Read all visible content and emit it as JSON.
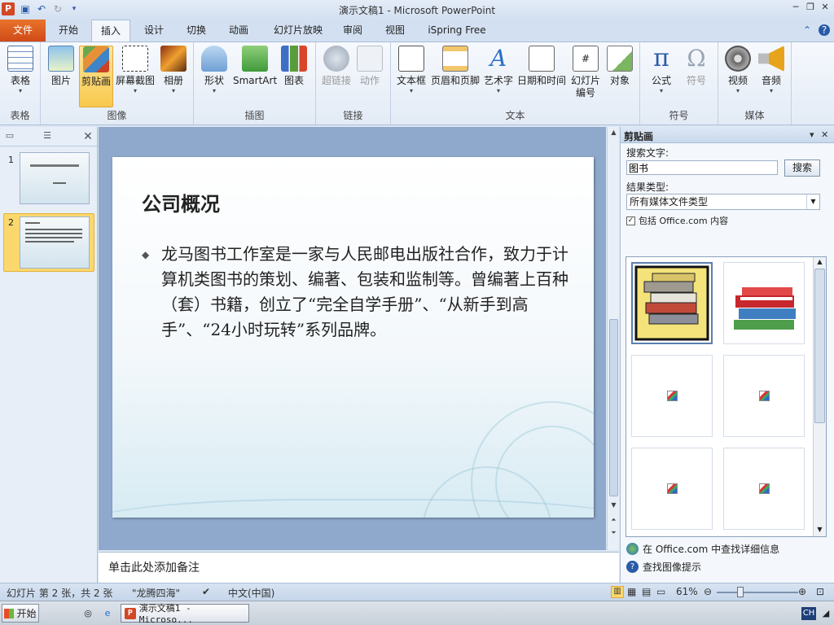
{
  "window": {
    "title": "演示文稿1 - Microsoft PowerPoint",
    "app_icon": "P",
    "controls": [
      "minimize-icon",
      "restore-icon",
      "close-icon"
    ]
  },
  "tabs": {
    "file": "文件",
    "items": [
      "开始",
      "插入",
      "设计",
      "切换",
      "动画",
      "幻灯片放映",
      "审阅",
      "视图",
      "iSpring Free"
    ],
    "active": "插入"
  },
  "ribbon": {
    "groups": {
      "table": "表格",
      "images": "图像",
      "illustrations": "插图",
      "links": "链接",
      "text": "文本",
      "symbols": "符号",
      "media": "媒体"
    },
    "buttons": {
      "table": "表格",
      "picture": "图片",
      "clipart": "剪贴画",
      "screenshot": "屏幕截图",
      "album": "相册",
      "shapes": "形状",
      "smartart": "SmartArt",
      "chart": "图表",
      "hyperlink": "超链接",
      "action": "动作",
      "textbox": "文本框",
      "header_footer": "页眉和页脚",
      "wordart": "艺术字",
      "datetime": "日期和时间",
      "slide_number_1": "幻灯片",
      "slide_number_2": "编号",
      "object": "对象",
      "equation": "公式",
      "symbol": "符号",
      "video": "视频",
      "audio": "音频"
    }
  },
  "slides_panel": {
    "slides": [
      {
        "number": "1",
        "title": "龙马工作室产品宣传"
      },
      {
        "number": "2",
        "title": "公司概况"
      }
    ],
    "selected": 2
  },
  "slide": {
    "title": "公司概况",
    "body": "龙马图书工作室是一家与人民邮电出版社合作，致力于计算机类图书的策划、编著、包装和监制等。曾编著上百种（套）书籍，创立了“完全自学手册”、“从新手到高手”、“24小时玩转”系列品牌。",
    "bullet": "◆"
  },
  "notes": {
    "placeholder": "单击此处添加备注"
  },
  "clipart": {
    "title": "剪贴画",
    "search_label": "搜索文字:",
    "search_value": "图书",
    "search_button": "搜索",
    "type_label": "结果类型:",
    "type_value": "所有媒体文件类型",
    "include_office": "包括 Office.com 内容",
    "include_checked": true,
    "results": [
      "books-stack-clipart",
      "books-pile-clipart",
      "broken-image",
      "broken-image",
      "broken-image",
      "broken-image"
    ],
    "link_office": "在 Office.com 中查找详细信息",
    "link_tips": "查找图像提示"
  },
  "status": {
    "slide_info": "幻灯片 第 2 张，共 2 张",
    "theme": "\"龙腾四海\"",
    "language": "中文(中国)",
    "zoom": "61%"
  },
  "taskbar": {
    "start": "开始",
    "task": "演示文稿1 - Microso...",
    "ime": "CH"
  },
  "colors": {
    "file_tab": "#d04a18",
    "selected_button": "#f9c94e",
    "ribbon": "#e3ebf6"
  }
}
